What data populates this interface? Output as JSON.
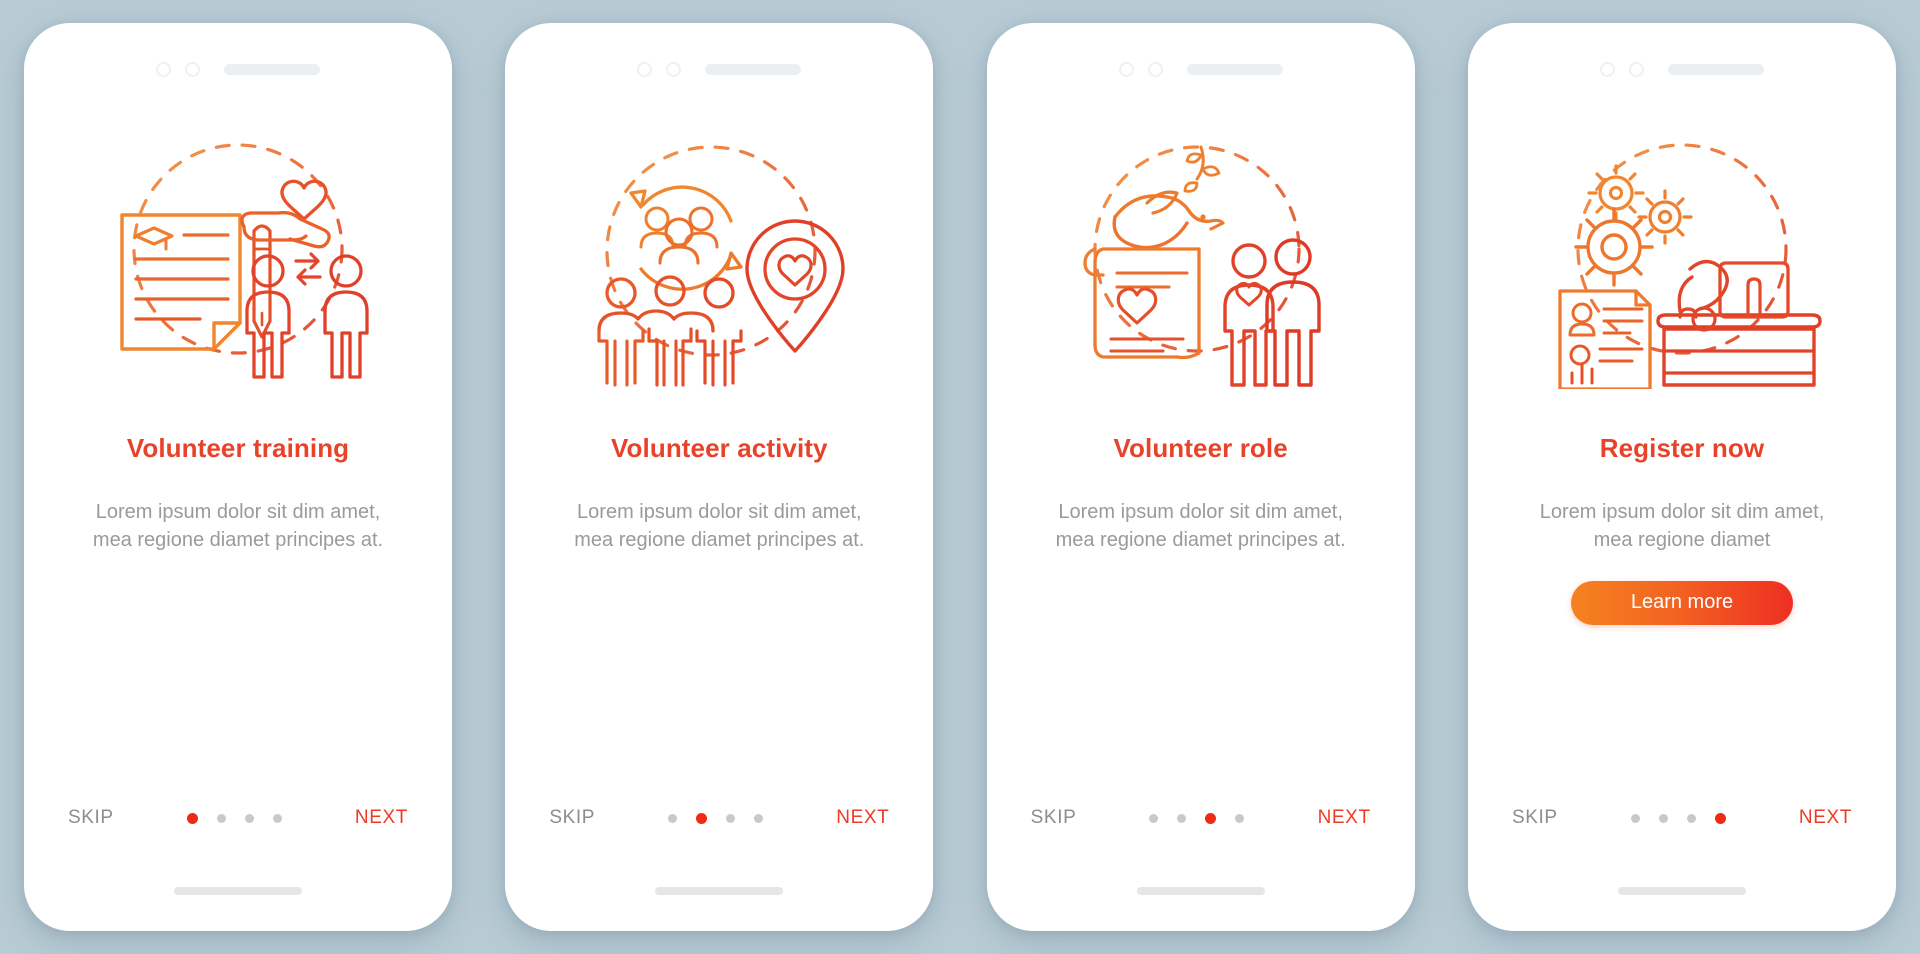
{
  "background_color": "#b9ccd6",
  "accent_colors": {
    "title": "#e8432a",
    "next": "#ee3b26",
    "skip": "#8d8d8d",
    "body": "#9a9a9a",
    "dot_active": "#ef2b15",
    "dot_inactive": "#c9c9c9",
    "button_gradient_start": "#f58220",
    "button_gradient_end": "#ee2f22",
    "illustration_light": "#f08a33",
    "illustration_dark": "#e1462a"
  },
  "screens": [
    {
      "id": "volunteer-training",
      "title": "Volunteer training",
      "body": "Lorem ipsum dolor sit dim amet, mea regione diamet principes at.",
      "skip_label": "SKIP",
      "next_label": "NEXT",
      "dots_total": 4,
      "active_dot": 1,
      "has_button": false,
      "illustration_name": "document-graduation-hand-heart-people-exchange"
    },
    {
      "id": "volunteer-activity",
      "title": "Volunteer activity",
      "body": "Lorem ipsum dolor sit dim amet, mea regione diamet principes at.",
      "skip_label": "SKIP",
      "next_label": "NEXT",
      "dots_total": 4,
      "active_dot": 2,
      "has_button": false,
      "illustration_name": "group-cycle-people-location-pin-heart"
    },
    {
      "id": "volunteer-role",
      "title": "Volunteer role",
      "body": "Lorem ipsum dolor sit dim amet, mea regione diamet principes at.",
      "skip_label": "SKIP",
      "next_label": "NEXT",
      "dots_total": 4,
      "active_dot": 3,
      "has_button": false,
      "illustration_name": "dove-olive-branch-scroll-heart-family"
    },
    {
      "id": "register-now",
      "title": "Register now",
      "body": "Lorem ipsum dolor sit dim amet, mea regione diamet",
      "button_label": "Learn more",
      "skip_label": "SKIP",
      "next_label": "NEXT",
      "dots_total": 4,
      "active_dot": 4,
      "has_button": true,
      "illustration_name": "gears-resume-reception-desk-clerk"
    }
  ]
}
